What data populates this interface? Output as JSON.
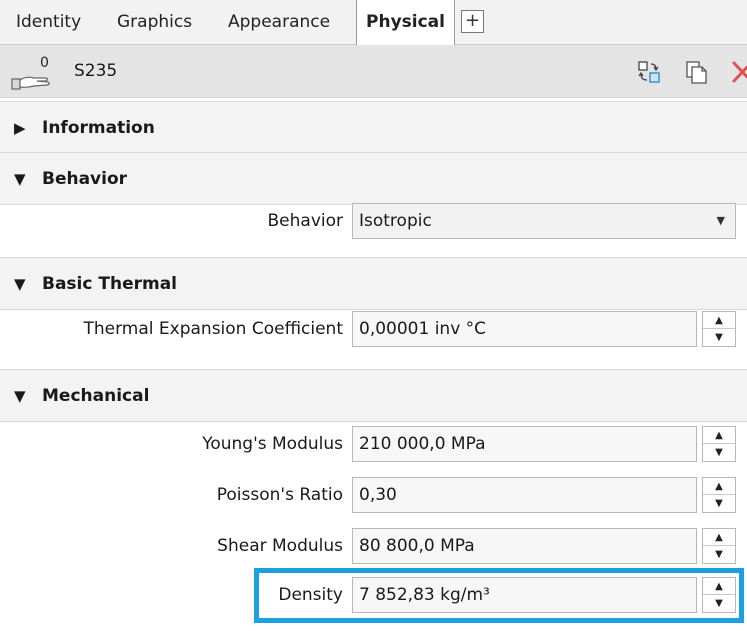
{
  "tabs": [
    {
      "label": "Identity"
    },
    {
      "label": "Graphics"
    },
    {
      "label": "Appearance"
    },
    {
      "label": "Physical"
    }
  ],
  "tab_add_label": "+",
  "material": {
    "hand_count": "0",
    "name": "S235"
  },
  "sections": {
    "information": {
      "arrow": "▶",
      "title": "Information"
    },
    "behavior": {
      "arrow": "▼",
      "title": "Behavior"
    },
    "basic_thermal": {
      "arrow": "▼",
      "title": "Basic Thermal"
    },
    "mechanical": {
      "arrow": "▼",
      "title": "Mechanical"
    }
  },
  "properties": {
    "behavior": {
      "label": "Behavior",
      "value": "Isotropic"
    },
    "thermal_expansion": {
      "label": "Thermal Expansion Coefficient",
      "value": "0,00001 inv °C"
    },
    "youngs_modulus": {
      "label": "Young's Modulus",
      "value": "210 000,0 MPa"
    },
    "poissons_ratio": {
      "label": "Poisson's Ratio",
      "value": "0,30"
    },
    "shear_modulus": {
      "label": "Shear Modulus",
      "value": "80 800,0 MPa"
    },
    "density": {
      "label": "Density",
      "value": "7 852,83 kg/m³"
    }
  },
  "colors": {
    "highlight": "#1ba1e2",
    "delete_icon": "#e05050"
  }
}
